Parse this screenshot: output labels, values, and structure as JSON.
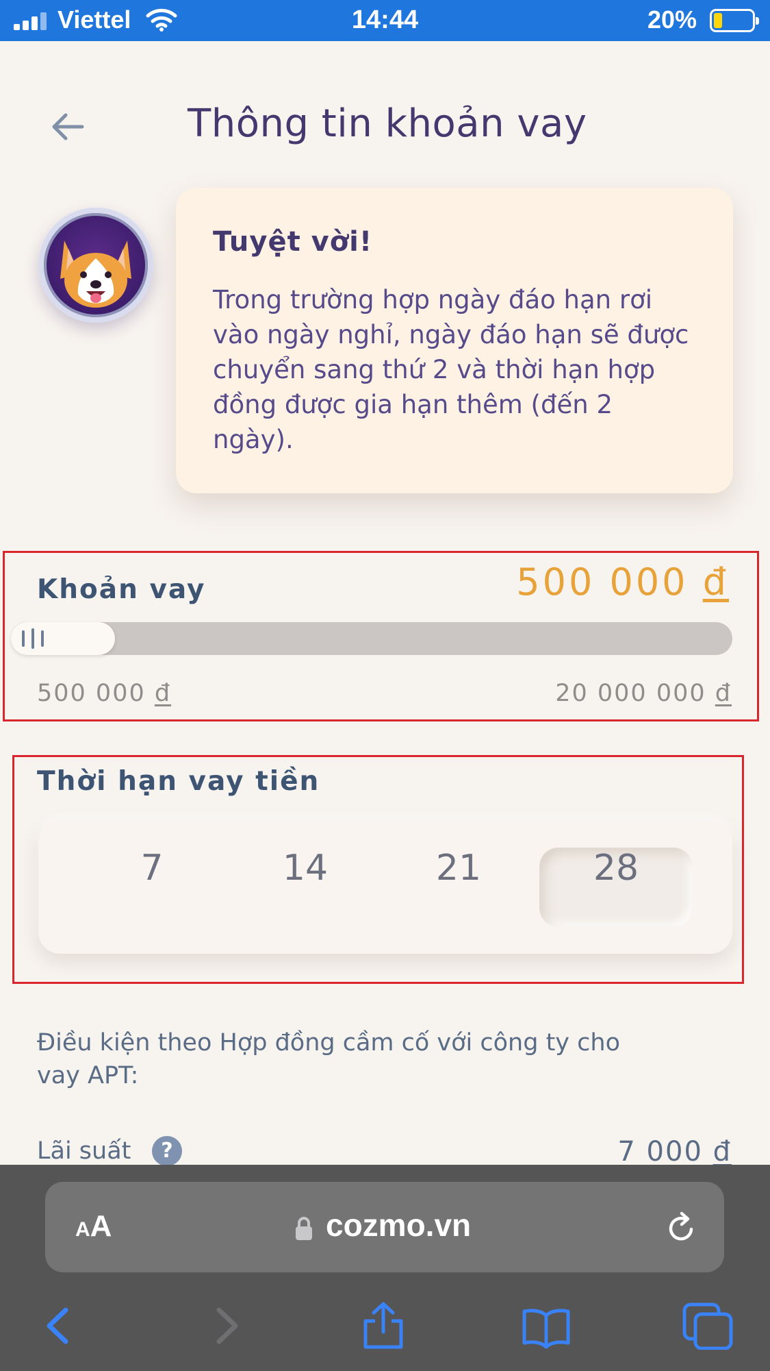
{
  "status_bar": {
    "carrier": "Viettel",
    "time": "14:44",
    "battery_percent": "20%",
    "battery_level": 0.2,
    "battery_color": "#ffd60a",
    "background_color": "#1f76dc"
  },
  "header": {
    "title": "Thông tin khoản vay",
    "back_icon": "back-arrow-icon"
  },
  "message": {
    "title": "Tuyệt vời!",
    "text": "Trong trường hợp ngày đáo hạn rơi vào ngày nghỉ, ngày đáo hạn sẽ được chuyển sang thứ 2 và thời hạn hợp đồng được gia hạn thêm (đến 2 ngày)."
  },
  "loan": {
    "label": "Khoản vay",
    "value": "500 000",
    "currency": "đ",
    "min": "500 000",
    "max": "20 000 000",
    "slider_level": 0,
    "value_color": "#e8a23a"
  },
  "term": {
    "label": "Thời hạn vay tiền",
    "options": [
      "7",
      "14",
      "21",
      "28"
    ],
    "selected": "28"
  },
  "conditions": {
    "text": "Điều kiện theo Hợp đồng cầm cố với công ty cho vay APT:",
    "rate_label": "Lãi suất",
    "rate_help": "?",
    "rate_value": "7 000",
    "currency": "đ"
  },
  "browser": {
    "text_size_small": "A",
    "text_size_big": "A",
    "url": "cozmo.vn",
    "icons": [
      "lock-icon",
      "reload-icon",
      "back-icon",
      "forward-icon",
      "share-icon",
      "bookmarks-icon",
      "tabs-icon"
    ],
    "accent_color": "#3a82f7"
  }
}
